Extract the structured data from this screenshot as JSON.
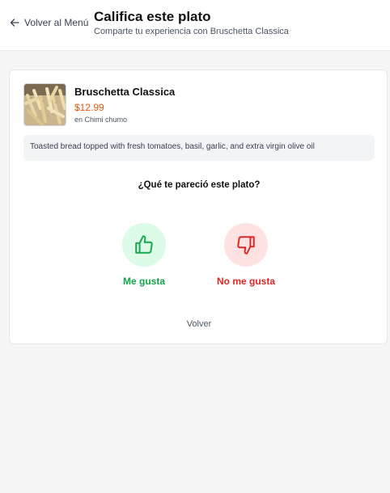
{
  "header": {
    "back_label": "Volver al Menú",
    "title": "Califica este plato",
    "subtitle": "Comparte tu experiencia con Bruschetta Classica"
  },
  "dish": {
    "name": "Bruschetta Classica",
    "price": "$12.99",
    "restaurant": "en Chimi chumo",
    "description": "Toasted bread topped with fresh tomatoes, basil, garlic, and extra virgin olive oil"
  },
  "rating": {
    "question": "¿Qué te pareció este plato?",
    "like_label": "Me gusta",
    "dislike_label": "No me gusta",
    "like_icon": "thumbs-up-icon",
    "dislike_icon": "thumbs-down-icon"
  },
  "footer": {
    "back_label": "Volver"
  },
  "colors": {
    "price": "#ea580c",
    "like": "#16a34a",
    "like_bg": "#dcfce7",
    "dislike": "#dc2626",
    "dislike_bg": "#fee2e2"
  }
}
